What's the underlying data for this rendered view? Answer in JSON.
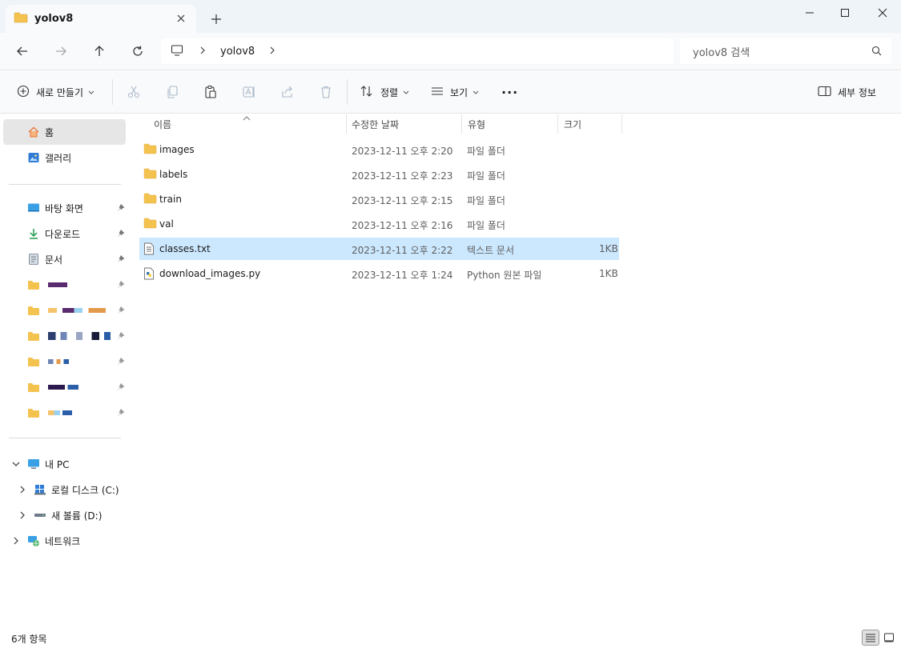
{
  "window": {
    "tab_title": "yolov8",
    "new_tab": "+"
  },
  "address": {
    "crumb": "yolov8",
    "search_placeholder": "yolov8 검색"
  },
  "commands": {
    "new": "새로 만들기",
    "sort": "정렬",
    "view": "보기",
    "more": "···",
    "details": "세부 정보"
  },
  "sidebar": {
    "top": [
      {
        "label": "홈",
        "icon": "home-icon"
      },
      {
        "label": "갤러리",
        "icon": "gallery-icon"
      }
    ],
    "quick": [
      {
        "label": "바탕 화면",
        "icon": "desktop-icon"
      },
      {
        "label": "다운로드",
        "icon": "download-icon"
      },
      {
        "label": "문서",
        "icon": "document-icon"
      }
    ],
    "pc": {
      "label": "내 PC",
      "drives": [
        {
          "label": "로컬 디스크 (C:)"
        },
        {
          "label": "새 볼륨 (D:)"
        }
      ]
    },
    "network": "네트워크"
  },
  "columns": {
    "name": "이름",
    "modified": "수정한 날짜",
    "type": "유형",
    "size": "크기"
  },
  "files": [
    {
      "name": "images",
      "modified": "2023-12-11 오후 2:20",
      "type": "파일 폴더",
      "size": "",
      "icon": "folder-icon"
    },
    {
      "name": "labels",
      "modified": "2023-12-11 오후 2:23",
      "type": "파일 폴더",
      "size": "",
      "icon": "folder-icon"
    },
    {
      "name": "train",
      "modified": "2023-12-11 오후 2:15",
      "type": "파일 폴더",
      "size": "",
      "icon": "folder-icon"
    },
    {
      "name": "val",
      "modified": "2023-12-11 오후 2:16",
      "type": "파일 폴더",
      "size": "",
      "icon": "folder-icon"
    },
    {
      "name": "classes.txt",
      "modified": "2023-12-11 오후 2:22",
      "type": "텍스트 문서",
      "size": "1KB",
      "icon": "text-file-icon",
      "selected": true
    },
    {
      "name": "download_images.py",
      "modified": "2023-12-11 오후 1:24",
      "type": "Python 원본 파일",
      "size": "1KB",
      "icon": "python-file-icon"
    }
  ],
  "status": {
    "count": "6개 항목"
  },
  "colors": {
    "folder": "#f4c24f",
    "selection": "#cce8ff",
    "accent": "#0067c0"
  }
}
